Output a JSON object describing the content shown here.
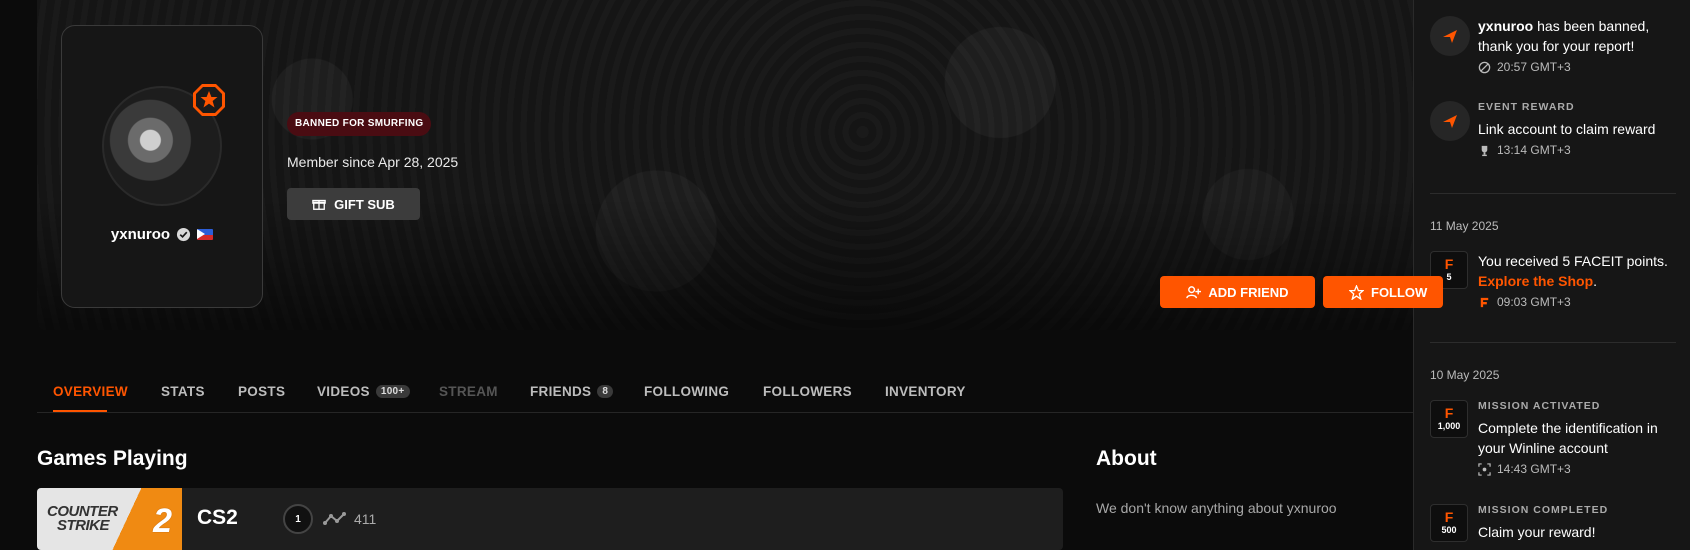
{
  "profile": {
    "username": "yxnuroo",
    "ban_label": "BANNED FOR SMURFING",
    "member_since": "Member since Apr 28, 2025",
    "gift_sub_label": "GIFT SUB",
    "add_friend_label": "ADD FRIEND",
    "follow_label": "FOLLOW"
  },
  "tabs": [
    {
      "label": "OVERVIEW"
    },
    {
      "label": "STATS"
    },
    {
      "label": "POSTS"
    },
    {
      "label": "VIDEOS",
      "count": "100+"
    },
    {
      "label": "STREAM"
    },
    {
      "label": "FRIENDS",
      "count": "8"
    },
    {
      "label": "FOLLOWING"
    },
    {
      "label": "FOLLOWERS"
    },
    {
      "label": "INVENTORY"
    }
  ],
  "games_section": {
    "title": "Games Playing",
    "game": {
      "logo_line1": "COUNTER",
      "logo_line2": "STRIKE",
      "logo_num": "2",
      "name": "CS2",
      "skill_level": "1",
      "elo": "411"
    }
  },
  "about_section": {
    "title": "About",
    "text": "We don't know anything about yxnuroo"
  },
  "notifications": {
    "n1": {
      "user": "yxnuroo",
      "text": " has been banned, thank you for your report!",
      "time": "20:57 GMT+3"
    },
    "n2": {
      "kind": "EVENT REWARD",
      "text": "Link account to claim reward",
      "time": "13:14 GMT+3"
    },
    "date1": "11 May 2025",
    "n3": {
      "badge": "5",
      "text": "You received 5 FACEIT points. ",
      "link": "Explore the Shop",
      "after": ".",
      "time": "09:03 GMT+3"
    },
    "date2": "10 May 2025",
    "n4": {
      "badge": "1,000",
      "kind": "MISSION ACTIVATED",
      "text": "Complete the identification in your Winline account",
      "time": "14:43 GMT+3"
    },
    "n5": {
      "badge": "500",
      "kind": "MISSION COMPLETED",
      "text": "Claim your reward!"
    }
  },
  "colors": {
    "accent": "#ff5500",
    "ban_bg": "#4a0c12"
  }
}
